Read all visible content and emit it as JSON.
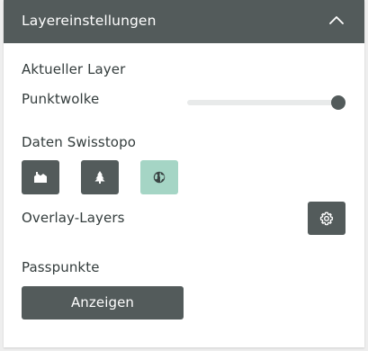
{
  "panel": {
    "title": "Layereinstellungen",
    "collapse_icon": "chevron-up-icon"
  },
  "current_layer": {
    "heading": "Aktueller Layer",
    "point_cloud": {
      "label": "Punktwolke",
      "opacity_fraction": 1.0
    }
  },
  "swisstopo": {
    "heading": "Daten Swisstopo",
    "buttons": [
      {
        "icon": "buildings-icon",
        "active": false
      },
      {
        "icon": "tree-icon",
        "active": false
      },
      {
        "icon": "globe-icon",
        "active": true
      }
    ]
  },
  "overlay": {
    "label": "Overlay-Layers",
    "settings_icon": "gear-icon"
  },
  "control_points": {
    "label": "Passpunkte",
    "button_label": "Anzeigen"
  },
  "colors": {
    "header_bg": "#535b5b",
    "button_bg": "#535b5b",
    "active_button_bg": "#a5d5c5",
    "text": "#333c3c",
    "slider_track": "#e8eaea"
  }
}
